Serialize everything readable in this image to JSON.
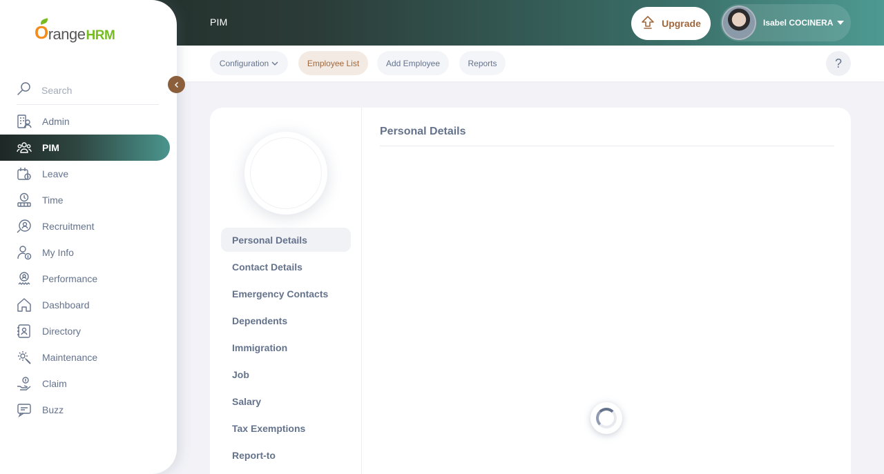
{
  "header": {
    "module_title": "PIM",
    "upgrade_label": "Upgrade",
    "user_name": "Isabel COCINERA"
  },
  "logo": {
    "brand": "range",
    "suffix": "HRM"
  },
  "sidebar": {
    "search_placeholder": "Search",
    "items": [
      {
        "label": "Admin",
        "icon": "admin-icon"
      },
      {
        "label": "PIM",
        "icon": "pim-icon",
        "active": true
      },
      {
        "label": "Leave",
        "icon": "leave-icon"
      },
      {
        "label": "Time",
        "icon": "time-icon"
      },
      {
        "label": "Recruitment",
        "icon": "recruitment-icon"
      },
      {
        "label": "My Info",
        "icon": "my-info-icon"
      },
      {
        "label": "Performance",
        "icon": "performance-icon"
      },
      {
        "label": "Dashboard",
        "icon": "dashboard-icon"
      },
      {
        "label": "Directory",
        "icon": "directory-icon"
      },
      {
        "label": "Maintenance",
        "icon": "maintenance-icon"
      },
      {
        "label": "Claim",
        "icon": "claim-icon"
      },
      {
        "label": "Buzz",
        "icon": "buzz-icon"
      }
    ]
  },
  "subnav": {
    "configuration": "Configuration",
    "employee_list": "Employee List",
    "add_employee": "Add Employee",
    "reports": "Reports",
    "help": "?"
  },
  "profile": {
    "tabs": [
      "Personal Details",
      "Contact Details",
      "Emergency Contacts",
      "Dependents",
      "Immigration",
      "Job",
      "Salary",
      "Tax Exemptions",
      "Report-to"
    ],
    "active_tab": "Personal Details",
    "section_title": "Personal Details"
  },
  "colors": {
    "accent": "#a0663c",
    "text": "#64728c",
    "brand_orange": "#f28c1c",
    "brand_green": "#76bc21"
  }
}
